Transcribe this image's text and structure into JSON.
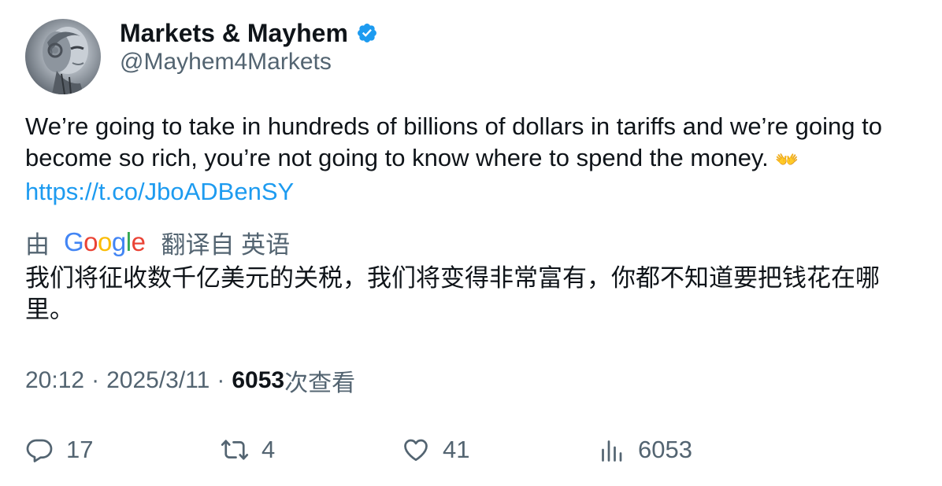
{
  "author": {
    "display_name": "Markets & Mayhem",
    "handle": "@Mayhem4Markets",
    "verified": true,
    "verified_color": "#1d9bf0",
    "avatar_icon": "robot-avatar"
  },
  "tweet": {
    "text": "We’re going to take in hundreds of billions of dollars in tariffs and we’re going to become so rich, you’re not going to know where to spend the money.",
    "emoji": "👐",
    "link": "https://t.co/JboADBenSY",
    "link_color": "#1d9bf0"
  },
  "translation": {
    "prefix": "由",
    "provider_letters": [
      "G",
      "o",
      "o",
      "g",
      "l",
      "e"
    ],
    "suffix": "翻译自 英语",
    "text": "我们将征收数千亿美元的关税，我们将变得非常富有，你都不知道要把钱花在哪里。"
  },
  "meta": {
    "time": "20:12",
    "separator": "·",
    "date": "2025/3/11",
    "views_count": "6053",
    "views_label": "次查看"
  },
  "actions": {
    "replies": "17",
    "retweets": "4",
    "likes": "41",
    "views": "6053"
  }
}
